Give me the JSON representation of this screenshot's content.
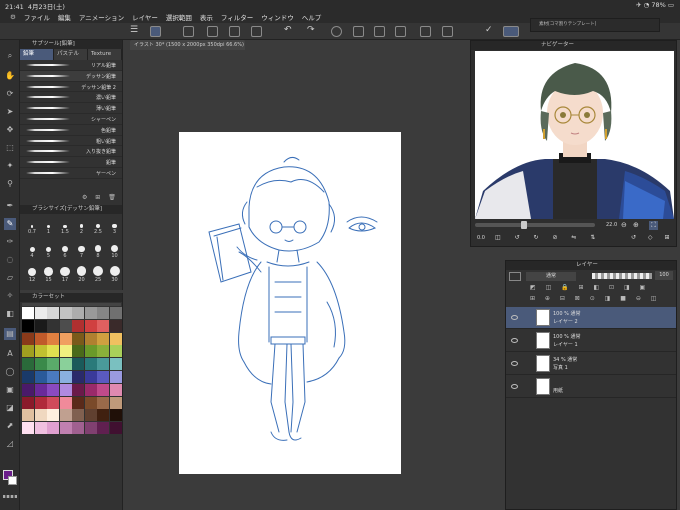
{
  "status": {
    "time": "21:41",
    "date": "4月23日(土)",
    "battery": "78%"
  },
  "menu": [
    "ファイル",
    "編集",
    "アニメーション",
    "レイヤー",
    "選択範囲",
    "表示",
    "フィルター",
    "ウィンドウ",
    "ヘルプ"
  ],
  "subtool": {
    "header": "サブツール[鉛筆]",
    "tabs": [
      "鉛筆",
      "パステル",
      "Texture"
    ],
    "brushes": [
      "リアル鉛筆",
      "デッサン鉛筆",
      "デッサン鉛筆 2",
      "濃い鉛筆",
      "薄い鉛筆",
      "シャーペン",
      "色鉛筆",
      "粗い鉛筆",
      "入り抜き鉛筆",
      "鉛筆",
      "ヤーペン"
    ],
    "selected_index": 1
  },
  "brush_size": {
    "header": "ブラシサイズ[デッサン鉛筆]",
    "sizes": [
      "0.7",
      "1",
      "1.5",
      "2",
      "2.5",
      "3",
      "4",
      "5",
      "6",
      "7",
      "8",
      "10",
      "12",
      "15",
      "17",
      "20",
      "25",
      "30"
    ]
  },
  "color_set": {
    "header": "カラーセット",
    "colors": [
      "#ffffff",
      "#ebebeb",
      "#d6d6d6",
      "#c2c2c2",
      "#adadad",
      "#999999",
      "#858585",
      "#707070",
      "#000000",
      "#1a1a1a",
      "#333333",
      "#4d4d4d",
      "#b03030",
      "#d04040",
      "#e06060",
      "#3a2a2a",
      "#8a3a1a",
      "#c05a2a",
      "#e08040",
      "#f0a060",
      "#7a5a1a",
      "#b08030",
      "#d0a040",
      "#f0c060",
      "#a0a020",
      "#c0c030",
      "#e0e050",
      "#f0f080",
      "#4a6a1a",
      "#6a9a2a",
      "#8ab03a",
      "#aad05a",
      "#2a6a3a",
      "#3a8a4a",
      "#5aaa6a",
      "#8ad09a",
      "#1a5a5a",
      "#2a7a7a",
      "#4a9a9a",
      "#7ac0c0",
      "#1a3a6a",
      "#2a5a9a",
      "#4a7ac0",
      "#8ab0e0",
      "#2a2a6a",
      "#3a3a9a",
      "#5a5ac0",
      "#9a9ae0",
      "#4a1a6a",
      "#6a2a9a",
      "#8a4ac0",
      "#b08ae0",
      "#6a1a4a",
      "#9a2a6a",
      "#c04a8a",
      "#e08ab0",
      "#8a1a2a",
      "#b02a3a",
      "#d04a5a",
      "#f08a9a",
      "#5a2a1a",
      "#7a4a2a",
      "#9a6a4a",
      "#c09a7a",
      "#e0c0a0",
      "#f0d8c0",
      "#fff0e0",
      "#c0a090",
      "#806050",
      "#604030",
      "#402010",
      "#201008",
      "#ffe0f0",
      "#f0c0e0",
      "#e0a0d0",
      "#c080b0",
      "#a06090",
      "#804070",
      "#602050",
      "#401030"
    ]
  },
  "canvas": {
    "tab_title": "イラスト 30* (1500 x 2000px 350dpi 66.6%)"
  },
  "history": {
    "title": "素材[コマ割りテンプレート]"
  },
  "navigator": {
    "title": "ナビゲーター",
    "zoom": "22.0",
    "angle": "0.0"
  },
  "layers": {
    "title": "レイヤー",
    "blend": "通常",
    "opacity": "100",
    "rows": [
      {
        "line1": "100 % 通常",
        "line2": "レイヤー 2"
      },
      {
        "line1": "100 % 通常",
        "line2": "レイヤー 1"
      },
      {
        "line1": "34 % 通常",
        "line2": "写真 1"
      },
      {
        "line1": "",
        "line2": "用紙"
      }
    ]
  }
}
